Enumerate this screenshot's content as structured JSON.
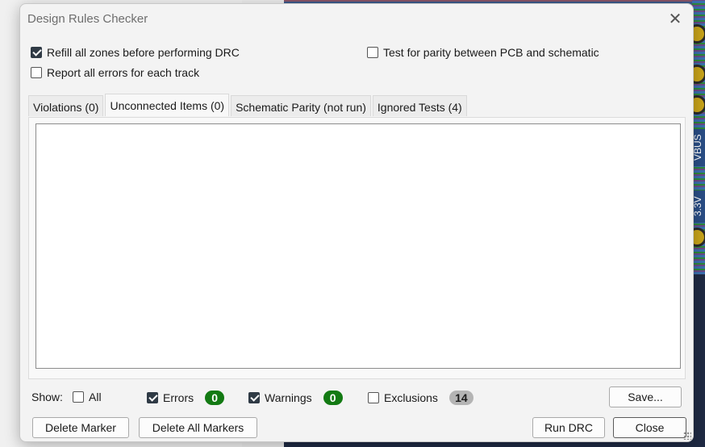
{
  "window": {
    "title": "Design Rules Checker"
  },
  "background": {
    "labels": [
      "VBUS",
      "3.3V"
    ]
  },
  "options": {
    "refill_zones": {
      "label": "Refill all zones before performing DRC",
      "checked": true
    },
    "report_all_errors": {
      "label": "Report all errors for each track",
      "checked": false
    },
    "test_parity": {
      "label": "Test for parity between PCB and schematic",
      "checked": false
    }
  },
  "tabs": [
    {
      "label": "Violations (0)",
      "active": false
    },
    {
      "label": "Unconnected Items (0)",
      "active": true
    },
    {
      "label": "Schematic Parity (not run)",
      "active": false
    },
    {
      "label": "Ignored Tests (4)",
      "active": false
    }
  ],
  "filter": {
    "show_label": "Show:",
    "all": {
      "label": "All",
      "checked": false
    },
    "errors": {
      "label": "Errors",
      "checked": true,
      "count": "0",
      "color": "#137a13"
    },
    "warnings": {
      "label": "Warnings",
      "checked": true,
      "count": "0",
      "color": "#137a13"
    },
    "exclusions": {
      "label": "Exclusions",
      "checked": false,
      "count": "14",
      "color": "#b4b4b4"
    }
  },
  "buttons": {
    "save": "Save...",
    "delete_marker": "Delete Marker",
    "delete_all_markers": "Delete All Markers",
    "run_drc": "Run DRC",
    "close": "Close"
  }
}
